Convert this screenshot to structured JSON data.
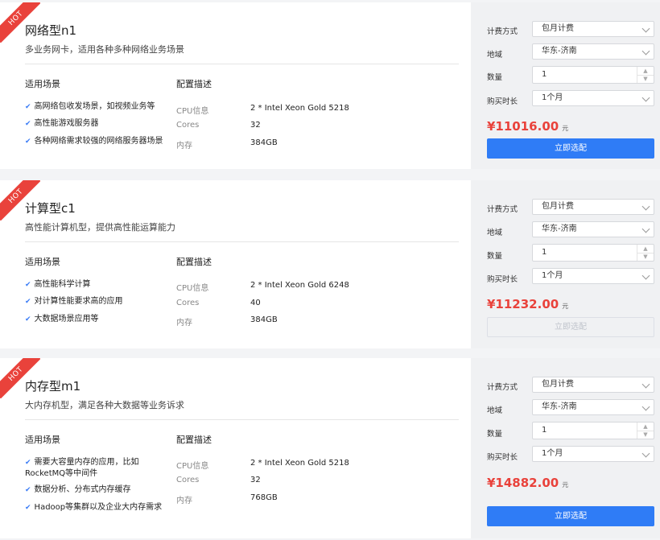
{
  "labels": {
    "hot": "HOT",
    "col_scenarios": "适用场景",
    "col_config": "配置描述",
    "billing": "计费方式",
    "region": "地域",
    "quantity": "数量",
    "duration": "购买时长",
    "yuan": "元",
    "select_button": "立即选配"
  },
  "spec_keys": {
    "cpu": "CPU信息",
    "cores": "Cores",
    "mem": "内存"
  },
  "cards": [
    {
      "title": "网络型n1",
      "subtitle": "多业务网卡，适用各种多种网络业务场景",
      "scenarios": [
        "高网络包收发场景，如视频业务等",
        "高性能游戏服务器",
        "各种网络需求较强的网络服务器场景"
      ],
      "cpu": "2 * Intel Xeon Gold 5218",
      "cores": "32",
      "mem": "384GB",
      "billing": "包月计费",
      "region": "华东-济南",
      "quantity": "1",
      "duration": "1个月",
      "price": "¥11016.00",
      "button_state": "enabled"
    },
    {
      "title": "计算型c1",
      "subtitle": "高性能计算机型，提供高性能运算能力",
      "scenarios": [
        "高性能科学计算",
        "对计算性能要求高的应用",
        "大数据场景应用等"
      ],
      "cpu": "2 * Intel Xeon Gold 6248",
      "cores": "40",
      "mem": "384GB",
      "billing": "包月计费",
      "region": "华东-济南",
      "quantity": "1",
      "duration": "1个月",
      "price": "¥11232.00",
      "button_state": "disabled"
    },
    {
      "title": "内存型m1",
      "subtitle": "大内存机型，满足各种大数据等业务诉求",
      "scenarios": [
        "需要大容量内存的应用，比如RocketMQ等中间件",
        "数据分析、分布式内存缓存",
        "Hadoop等集群以及企业大内存需求"
      ],
      "cpu": "2 * Intel Xeon Gold 5218",
      "cores": "32",
      "mem": "768GB",
      "billing": "包月计费",
      "region": "华东-济南",
      "quantity": "1",
      "duration": "1个月",
      "price": "¥14882.00",
      "button_state": "enabled"
    }
  ],
  "colors": {
    "accent": "#2f7cf6",
    "price": "#e9423b",
    "hot": "#e9423b"
  }
}
